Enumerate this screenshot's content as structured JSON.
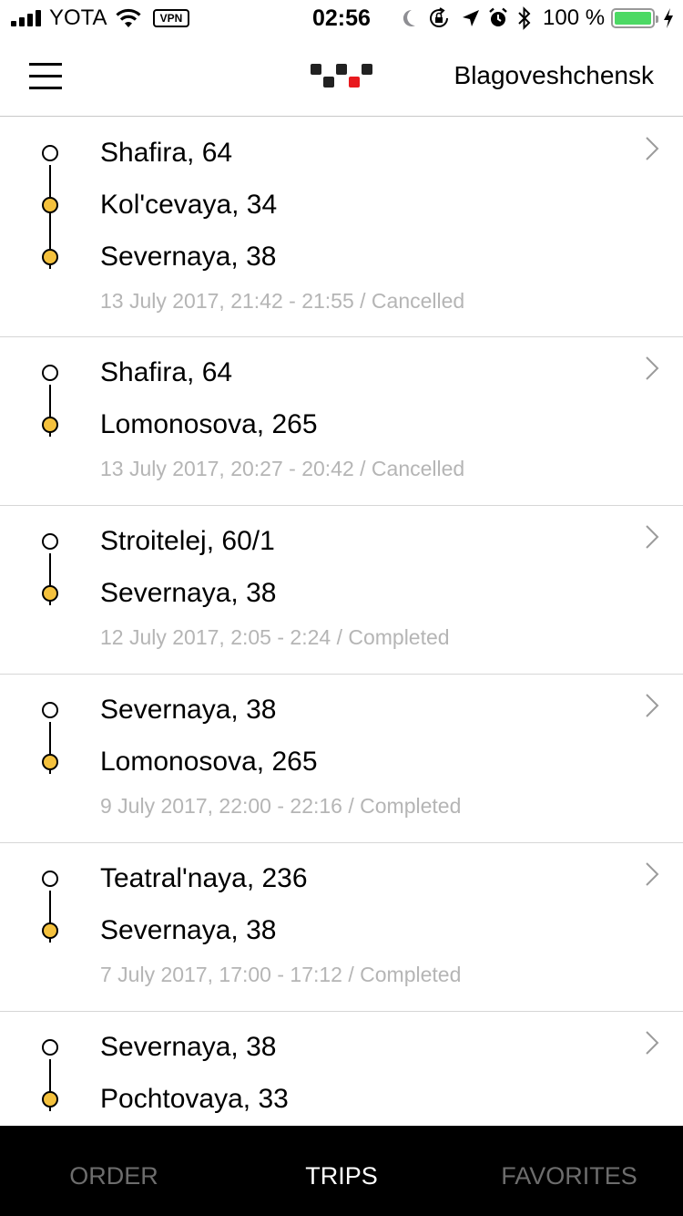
{
  "status_bar": {
    "carrier": "YOTA",
    "vpn": "VPN",
    "time": "02:56",
    "battery_percent": "100 %",
    "battery_level": 1.0,
    "battery_color": "#4cd964",
    "icons": [
      "signal-icon",
      "wifi-icon",
      "moon-icon",
      "rotation-lock-icon",
      "location-icon",
      "alarm-icon",
      "bluetooth-icon",
      "battery-icon",
      "charging-icon"
    ]
  },
  "header": {
    "menu_icon": "hamburger-menu-icon",
    "logo": "taxi-checker-logo",
    "city": "Blagoveshchensk"
  },
  "colors": {
    "accent_stop": "#f4c13d",
    "logo_accent": "#e8191e",
    "meta_text": "#b5b5b5",
    "tab_active": "#ffffff",
    "tab_inactive": "#6d6d6d"
  },
  "trips": [
    {
      "stops": [
        "Shafira, 64",
        "Kol'cevaya, 34",
        "Severnaya, 38"
      ],
      "meta": "13 July 2017, 21:42 - 21:55 / Cancelled"
    },
    {
      "stops": [
        "Shafira, 64",
        "Lomonosova, 265"
      ],
      "meta": "13 July 2017, 20:27 - 20:42 / Cancelled"
    },
    {
      "stops": [
        "Stroitelej, 60/1",
        "Severnaya, 38"
      ],
      "meta": "12 July 2017, 2:05 - 2:24 / Completed"
    },
    {
      "stops": [
        "Severnaya, 38",
        "Lomonosova, 265"
      ],
      "meta": "9 July 2017, 22:00 - 22:16 / Completed"
    },
    {
      "stops": [
        "Teatral'naya, 236",
        "Severnaya, 38"
      ],
      "meta": "7 July 2017, 17:00 - 17:12 / Completed"
    },
    {
      "stops": [
        "Severnaya, 38",
        "Pochtovaya, 33"
      ],
      "meta": ""
    }
  ],
  "tabs": [
    {
      "label": "ORDER",
      "active": false
    },
    {
      "label": "TRIPS",
      "active": true
    },
    {
      "label": "FAVORITES",
      "active": false
    }
  ]
}
